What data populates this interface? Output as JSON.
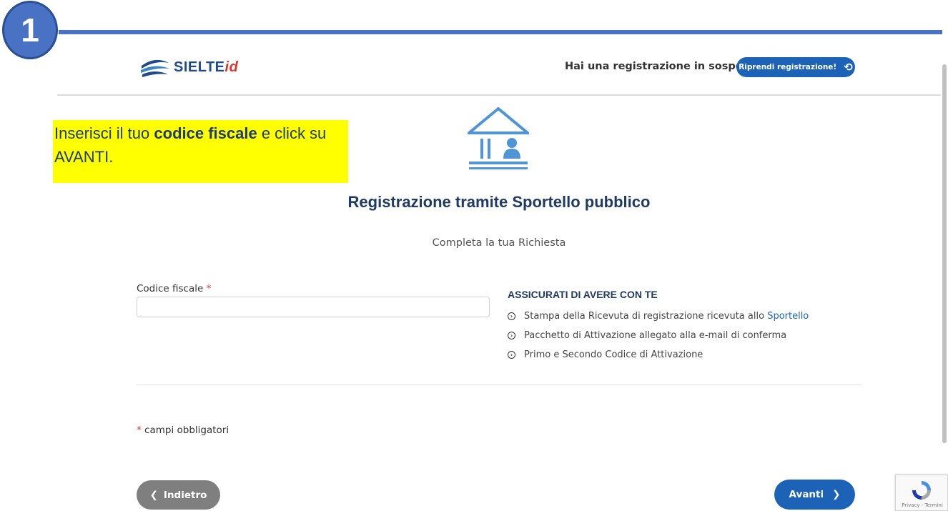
{
  "step": {
    "number": "1"
  },
  "header": {
    "brand": {
      "name": "SIELTE",
      "suffix": "id"
    },
    "pending_question": "Hai una registrazione in sospeso?",
    "resume_button": "Riprendi registrazione!"
  },
  "callout": {
    "before": "Inserisci il tuo ",
    "bold": "codice fiscale",
    "after": " e click su AVANTI."
  },
  "page": {
    "title": "Registrazione tramite Sportello pubblico",
    "subtitle": "Completa la tua Richiesta"
  },
  "form": {
    "codice_fiscale": {
      "label": "Codice fiscale",
      "required_mark": "*",
      "value": "",
      "placeholder": ""
    }
  },
  "checklist": {
    "title": "ASSICURATI DI AVERE CON TE",
    "items": [
      {
        "text": "Stampa della Ricevuta di registrazione ricevuta allo ",
        "link": "Sportello"
      },
      {
        "text": "Pacchetto di Attivazione allegato alla e-mail di conferma",
        "link": ""
      },
      {
        "text": "Primo e Secondo Codice di Attivazione",
        "link": ""
      }
    ]
  },
  "required_note": {
    "mark": "*",
    "text": "campi obbligatori"
  },
  "buttons": {
    "back": "Indietro",
    "next": "Avanti"
  },
  "recaptcha": {
    "links": "Privacy - Termini"
  },
  "colors": {
    "accent": "#1c63b8",
    "step": "#4a72c4",
    "highlight": "#ffff00",
    "title": "#1f3a63",
    "required": "#d63b2f"
  }
}
